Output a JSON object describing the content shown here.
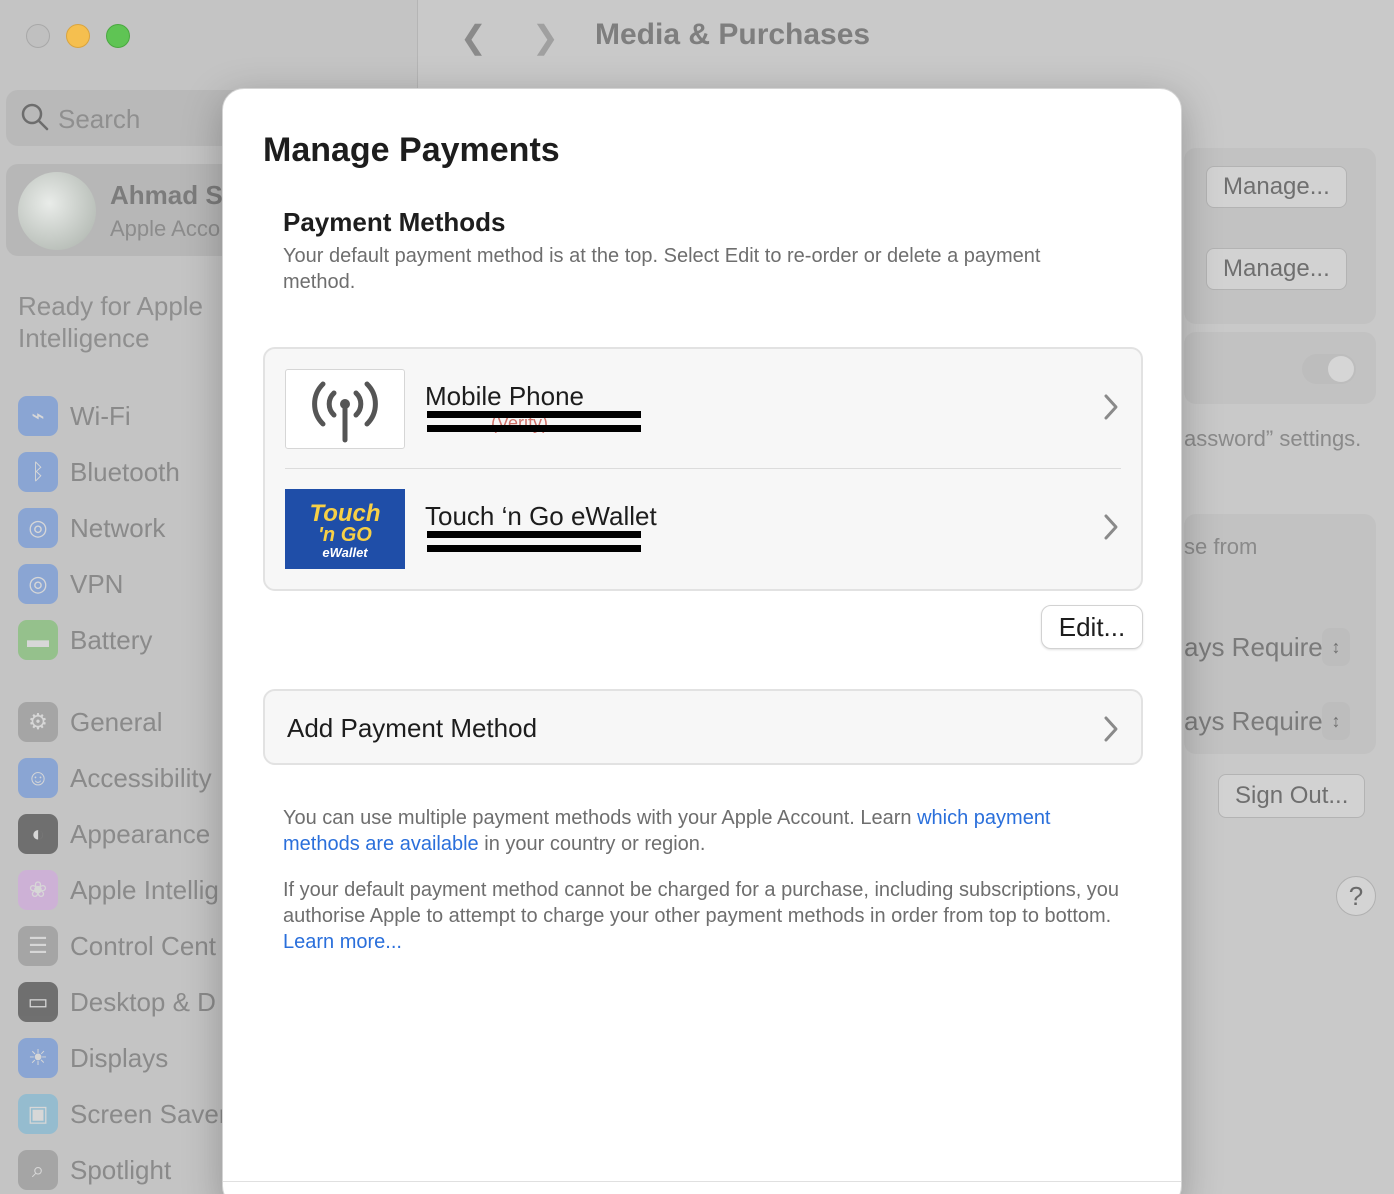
{
  "background": {
    "search": {
      "placeholder": "Search"
    },
    "account": {
      "name": "Ahmad S",
      "subtitle": "Apple Acco"
    },
    "ready_text": "Ready for Apple Intelligence",
    "sidebar_items": [
      {
        "label": "Wi-Fi",
        "icon": "wifi-icon",
        "color": "#5b8de0"
      },
      {
        "label": "Bluetooth",
        "icon": "bluetooth-icon",
        "color": "#5b8de0"
      },
      {
        "label": "Network",
        "icon": "globe-icon",
        "color": "#5b8de0"
      },
      {
        "label": "VPN",
        "icon": "vpn-icon",
        "color": "#5b8de0"
      },
      {
        "label": "Battery",
        "icon": "battery-icon",
        "color": "#6fbf5f"
      },
      {
        "label": "General",
        "icon": "gear-icon",
        "color": "#8d8d8d"
      },
      {
        "label": "Accessibility",
        "icon": "accessibility-icon",
        "color": "#5b8de0"
      },
      {
        "label": "Appearance",
        "icon": "appearance-icon",
        "color": "#2b2b2b"
      },
      {
        "label": "Apple Intellig",
        "icon": "apple-intelligence-icon",
        "color": "#d6a3e6"
      },
      {
        "label": "Control Cent",
        "icon": "control-center-icon",
        "color": "#8d8d8d"
      },
      {
        "label": "Desktop & D",
        "icon": "desktop-dock-icon",
        "color": "#2b2b2b"
      },
      {
        "label": "Displays",
        "icon": "displays-icon",
        "color": "#5b8de0"
      },
      {
        "label": "Screen Saver",
        "icon": "screen-saver-icon",
        "color": "#6fb6d9"
      },
      {
        "label": "Spotlight",
        "icon": "spotlight-icon",
        "color": "#8d8d8d"
      }
    ],
    "main_title": "Media & Purchases",
    "manage_btn_1": "Manage...",
    "manage_btn_2": "Manage...",
    "password_text": "assword” settings.",
    "se_from_text": "se from",
    "require_1": "ays Require",
    "require_2": "ays Require",
    "sign_out": "Sign Out...",
    "help": "?"
  },
  "sheet": {
    "title": "Manage Payments",
    "section_title": "Payment Methods",
    "section_desc": "Your default payment method is at the top. Select Edit to re-order or delete a payment method.",
    "payment_methods": [
      {
        "name": "Mobile Phone",
        "sub": "(Verify)"
      },
      {
        "name": "Touch ‘n Go eWallet",
        "logo_text_1": "Touch",
        "logo_text_2": "'n GO",
        "logo_text_3": "eWallet"
      }
    ],
    "edit_label": "Edit...",
    "add_label": "Add Payment Method",
    "note1_pre": "You can use multiple payment methods with your Apple Account. Learn ",
    "note1_link": "which payment methods are available",
    "note1_post": " in your country or region.",
    "note2_pre": "If your default payment method cannot be charged for a purchase, including subscriptions, you authorise Apple to attempt to charge your other payment methods in order from top to bottom. ",
    "note2_link": "Learn more..."
  }
}
